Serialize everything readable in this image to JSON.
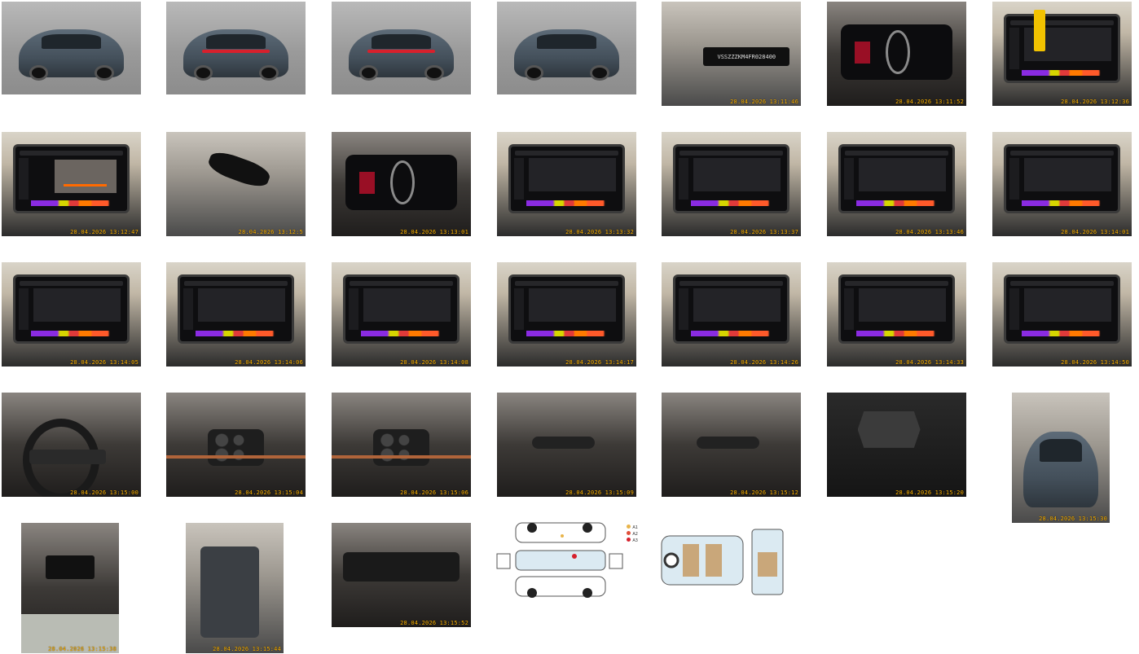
{
  "gallery": {
    "photos": [
      {
        "kind": "studio-front",
        "stamp": ""
      },
      {
        "kind": "studio-rear",
        "stamp": ""
      },
      {
        "kind": "studio-rear",
        "stamp": ""
      },
      {
        "kind": "studio-front",
        "stamp": ""
      },
      {
        "kind": "vin-plate",
        "stamp": "28.04.2026 13:11:46",
        "vin": "VSSZZZKM4FR028400"
      },
      {
        "kind": "cluster",
        "stamp": "28.04.2026 13:11:52"
      },
      {
        "kind": "screen-key",
        "stamp": "28.04.2026 13:12:36"
      },
      {
        "kind": "screen-camera",
        "stamp": "28.04.2026 13:12:47"
      },
      {
        "kind": "mirror",
        "stamp": "28.04.2026 13:12:5"
      },
      {
        "kind": "cluster",
        "stamp": "28.04.2026 13:13:01"
      },
      {
        "kind": "screen",
        "stamp": "28.04.2026 13:13:32"
      },
      {
        "kind": "screen",
        "stamp": "28.04.2026 13:13:37"
      },
      {
        "kind": "screen",
        "stamp": "28.04.2026 13:13:46"
      },
      {
        "kind": "screen",
        "stamp": "28.04.2026 13:14:01"
      },
      {
        "kind": "screen",
        "stamp": "28.04.2026 13:14:05"
      },
      {
        "kind": "screen",
        "stamp": "28.04.2026 13:14:06"
      },
      {
        "kind": "screen",
        "stamp": "28.04.2026 13:14:08"
      },
      {
        "kind": "screen",
        "stamp": "28.04.2026 13:14:17"
      },
      {
        "kind": "screen",
        "stamp": "28.04.2026 13:14:26"
      },
      {
        "kind": "screen",
        "stamp": "28.04.2026 13:14:33"
      },
      {
        "kind": "screen",
        "stamp": "28.04.2026 13:14:50"
      },
      {
        "kind": "steering",
        "stamp": "28.04.2026 13:15:00"
      },
      {
        "kind": "steering-buttons",
        "stamp": "28.04.2026 13:15:04"
      },
      {
        "kind": "steering-buttons",
        "stamp": "28.04.2026 13:15:06"
      },
      {
        "kind": "stalk",
        "stamp": "28.04.2026 13:15:09"
      },
      {
        "kind": "stalk",
        "stamp": "28.04.2026 13:15:12"
      },
      {
        "kind": "panel",
        "stamp": "28.04.2026 13:15:20"
      },
      {
        "kind": "trunk",
        "stamp": "28.04.2026 13:15:30"
      },
      {
        "kind": "rear-vents",
        "stamp": "28.04.2026 13:15:38"
      },
      {
        "kind": "door",
        "stamp": "28.04.2026 13:15:44"
      },
      {
        "kind": "dashboard",
        "stamp": "28.04.2026 13:15:52"
      },
      {
        "kind": "damage-diagram",
        "stamp": "",
        "legend": [
          "A1",
          "A2",
          "A3"
        ]
      },
      {
        "kind": "interior-diagram",
        "stamp": ""
      }
    ]
  },
  "colors": {
    "stamp": "#ffb400",
    "legend": [
      "#e8b44a",
      "#e0503a",
      "#d6202c"
    ]
  }
}
